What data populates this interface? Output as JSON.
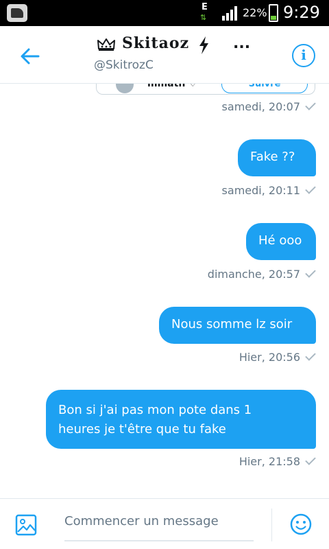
{
  "status_bar": {
    "network_label": "E",
    "battery_percent": "22%",
    "time": "9:29"
  },
  "header": {
    "title": "Skitaoz",
    "handle": "@SkitrozC",
    "more_label": "...",
    "info_label": "i"
  },
  "card": {
    "name": "mmath ♡",
    "follow_label": "Suivre"
  },
  "messages": [
    {
      "lines": [
        "Fake ??"
      ],
      "meta": "samedi, 20:11"
    },
    {
      "lines": [
        "Hé ooo"
      ],
      "meta": "dimanche, 20:57"
    },
    {
      "lines": [
        "Nous somme lz soir"
      ],
      "meta": "Hier, 20:56"
    },
    {
      "lines": [
        "Bon si j'ai pas mon pote dans 1",
        "heures je t'être que tu fake"
      ],
      "meta": "Hier, 21:58"
    }
  ],
  "card_meta": "samedi, 20:07",
  "composer": {
    "placeholder": "Commencer un message"
  },
  "colors": {
    "accent": "#1da1f2",
    "meta_text": "#657786",
    "status_bar": "#000000"
  },
  "icons": [
    "back-arrow-icon",
    "crown-icon",
    "lightning-icon",
    "info-icon",
    "photo-icon",
    "emoji-icon",
    "read-check-icon"
  ]
}
